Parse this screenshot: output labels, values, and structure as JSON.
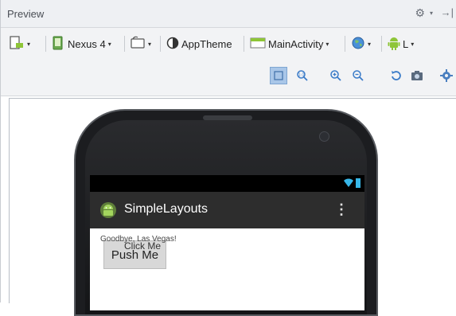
{
  "panel": {
    "title": "Preview"
  },
  "icons": {
    "gear": "⚙",
    "pin": "→|",
    "caret": "▾",
    "overflow": "⋮"
  },
  "toolbar": {
    "device_label": "Nexus 4",
    "theme_label": "AppTheme",
    "activity_label": "MainActivity",
    "api_label": "L"
  },
  "phone": {
    "app_title": "SimpleLayouts"
  },
  "layout": {
    "text_view": "Goodbye, Las Vegas!",
    "push_button": "Push Me",
    "click_button": "Click Me"
  },
  "colors": {
    "android_green": "#8ec537",
    "actionbar": "#2d2d2d",
    "statusbar_icon": "#37b7e8"
  }
}
